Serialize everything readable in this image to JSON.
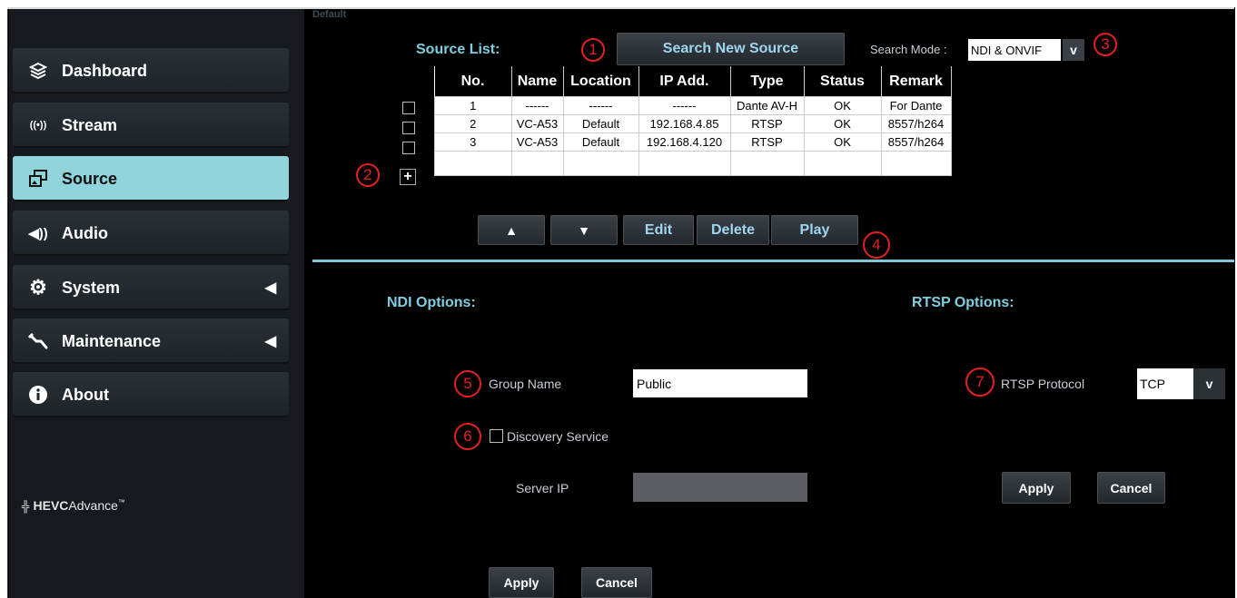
{
  "breadcrumb": "Default",
  "sidebar": {
    "items": [
      {
        "label": "Dashboard",
        "icon": "layers-icon"
      },
      {
        "label": "Stream",
        "icon": "broadcast-icon"
      },
      {
        "label": "Source",
        "icon": "source-icon"
      },
      {
        "label": "Audio",
        "icon": "speaker-icon"
      },
      {
        "label": "System",
        "icon": "gear-icon"
      },
      {
        "label": "Maintenance",
        "icon": "wrench-icon"
      },
      {
        "label": "About",
        "icon": "info-icon"
      }
    ],
    "active": "Source",
    "logo": {
      "prefix": "HEVC",
      "suffix": "Advance",
      "mark": "™"
    }
  },
  "source_list": {
    "title": "Source List:",
    "search_button": "Search New Source",
    "search_mode_label": "Search Mode :",
    "search_mode_value": "NDI & ONVIF",
    "columns": [
      "No.",
      "Name",
      "Location",
      "IP Add.",
      "Type",
      "Status",
      "Remark"
    ],
    "rows": [
      [
        "1",
        "------",
        "------",
        "------",
        "Dante AV-H",
        "OK",
        "For Dante"
      ],
      [
        "2",
        "VC-A53",
        "Default",
        "192.168.4.85",
        "RTSP",
        "OK",
        "8557/h264"
      ],
      [
        "3",
        "VC-A53",
        "Default",
        "192.168.4.120",
        "RTSP",
        "OK",
        "8557/h264"
      ]
    ],
    "add_label": "+",
    "actions": {
      "up": "▲",
      "down": "▼",
      "edit": "Edit",
      "delete": "Delete",
      "play": "Play"
    }
  },
  "ndi": {
    "title": "NDI Options:",
    "group_name_label": "Group Name",
    "group_name_value": "Public",
    "discovery_label": "Discovery Service",
    "server_ip_label": "Server IP",
    "server_ip_value": "",
    "apply": "Apply",
    "cancel": "Cancel"
  },
  "rtsp": {
    "title": "RTSP Options:",
    "protocol_label": "RTSP Protocol",
    "protocol_value": "TCP",
    "apply": "Apply",
    "cancel": "Cancel"
  },
  "callouts": [
    "1",
    "2",
    "3",
    "4",
    "5",
    "6",
    "7"
  ],
  "colors": {
    "accent": "#7fcfe0",
    "active_nav": "#8fd3db",
    "callout": "#e5201f"
  }
}
